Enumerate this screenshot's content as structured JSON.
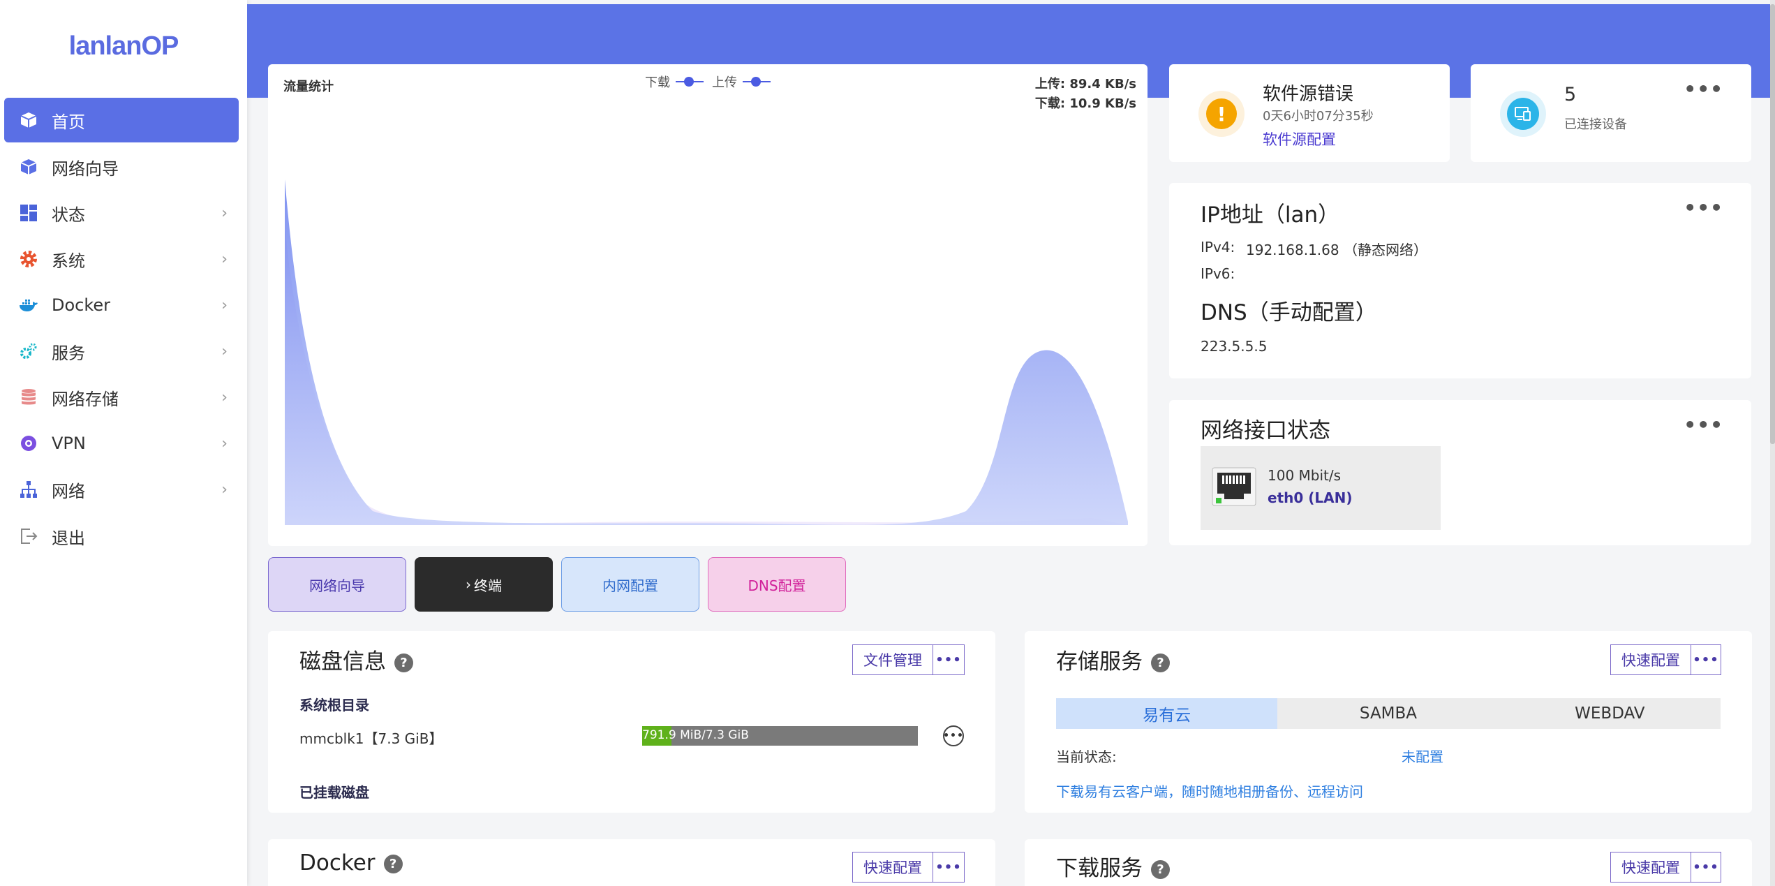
{
  "brand": "lanlanOP",
  "sidebar": {
    "items": [
      {
        "label": "首页"
      },
      {
        "label": "网络向导"
      },
      {
        "label": "状态"
      },
      {
        "label": "系统"
      },
      {
        "label": "Docker"
      },
      {
        "label": "服务"
      },
      {
        "label": "网络存储"
      },
      {
        "label": "VPN"
      },
      {
        "label": "网络"
      },
      {
        "label": "退出"
      }
    ]
  },
  "traffic": {
    "title": "流量统计",
    "legend_download": "下载",
    "legend_upload": "上传",
    "upload_rate": "上传: 89.4 KB/s",
    "download_rate": "下载: 10.9 KB/s"
  },
  "quick_buttons": {
    "wizard": "网络向导",
    "terminal": "终端",
    "lan": "内网配置",
    "dns": "DNS配置"
  },
  "software_source": {
    "title": "软件源错误",
    "elapsed": "0天6小时07分35秒",
    "link": "软件源配置"
  },
  "devices": {
    "count": "5",
    "label": "已连接设备"
  },
  "ip": {
    "title": "IP地址（lan）",
    "ipv4_label": "IPv4:",
    "ipv4_value": "192.168.1.68 （静态网络）",
    "ipv6_label": "IPv6:",
    "dns_title": "DNS（手动配置）",
    "dns_value": "223.5.5.5"
  },
  "interfaces": {
    "title": "网络接口状态",
    "speed": "100 Mbit/s",
    "name": "eth0 (LAN)"
  },
  "disk": {
    "title": "磁盘信息",
    "file_btn": "文件管理",
    "root_label": "系统根目录",
    "device": "mmcblk1【7.3 GiB】",
    "usage_used": "791.9",
    "usage_rest": " MiB/7.3 GiB",
    "usage_fraction": 0.106,
    "mounted_label": "已挂载磁盘"
  },
  "storage": {
    "title": "存储服务",
    "config_btn": "快速配置",
    "tabs": [
      "易有云",
      "SAMBA",
      "WEBDAV"
    ],
    "status_label": "当前状态:",
    "status_value": "未配置",
    "download_link": "下载易有云客户端，随时随地相册备份、远程访问"
  },
  "docker": {
    "title": "Docker",
    "config_btn": "快速配置"
  },
  "download_service": {
    "title": "下载服务",
    "config_btn": "快速配置"
  },
  "colors": {
    "accent": "#5b73e6",
    "download_fill": "#7f93f2",
    "upload_fill": "#e4d8f8"
  }
}
